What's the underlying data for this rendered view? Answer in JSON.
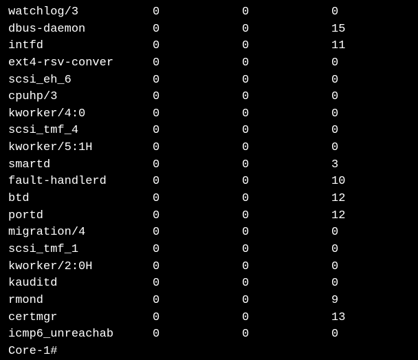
{
  "rows": [
    {
      "name": "watchlog/3",
      "c1": "0",
      "c2": "0",
      "c3": "0"
    },
    {
      "name": "dbus-daemon",
      "c1": "0",
      "c2": "0",
      "c3": "15"
    },
    {
      "name": "intfd",
      "c1": "0",
      "c2": "0",
      "c3": "11"
    },
    {
      "name": "ext4-rsv-conver",
      "c1": "0",
      "c2": "0",
      "c3": "0"
    },
    {
      "name": "scsi_eh_6",
      "c1": "0",
      "c2": "0",
      "c3": "0"
    },
    {
      "name": "cpuhp/3",
      "c1": "0",
      "c2": "0",
      "c3": "0"
    },
    {
      "name": "kworker/4:0",
      "c1": "0",
      "c2": "0",
      "c3": "0"
    },
    {
      "name": "scsi_tmf_4",
      "c1": "0",
      "c2": "0",
      "c3": "0"
    },
    {
      "name": "kworker/5:1H",
      "c1": "0",
      "c2": "0",
      "c3": "0"
    },
    {
      "name": "smartd",
      "c1": "0",
      "c2": "0",
      "c3": "3"
    },
    {
      "name": "fault-handlerd",
      "c1": "0",
      "c2": "0",
      "c3": "10"
    },
    {
      "name": "btd",
      "c1": "0",
      "c2": "0",
      "c3": "12"
    },
    {
      "name": "portd",
      "c1": "0",
      "c2": "0",
      "c3": "12"
    },
    {
      "name": "migration/4",
      "c1": "0",
      "c2": "0",
      "c3": "0"
    },
    {
      "name": "scsi_tmf_1",
      "c1": "0",
      "c2": "0",
      "c3": "0"
    },
    {
      "name": "kworker/2:0H",
      "c1": "0",
      "c2": "0",
      "c3": "0"
    },
    {
      "name": "kauditd",
      "c1": "0",
      "c2": "0",
      "c3": "0"
    },
    {
      "name": "rmond",
      "c1": "0",
      "c2": "0",
      "c3": "9"
    },
    {
      "name": "certmgr",
      "c1": "0",
      "c2": "0",
      "c3": "13"
    },
    {
      "name": "icmp6_unreachab",
      "c1": "0",
      "c2": "0",
      "c3": "0"
    }
  ],
  "prompt": "Core-1#"
}
